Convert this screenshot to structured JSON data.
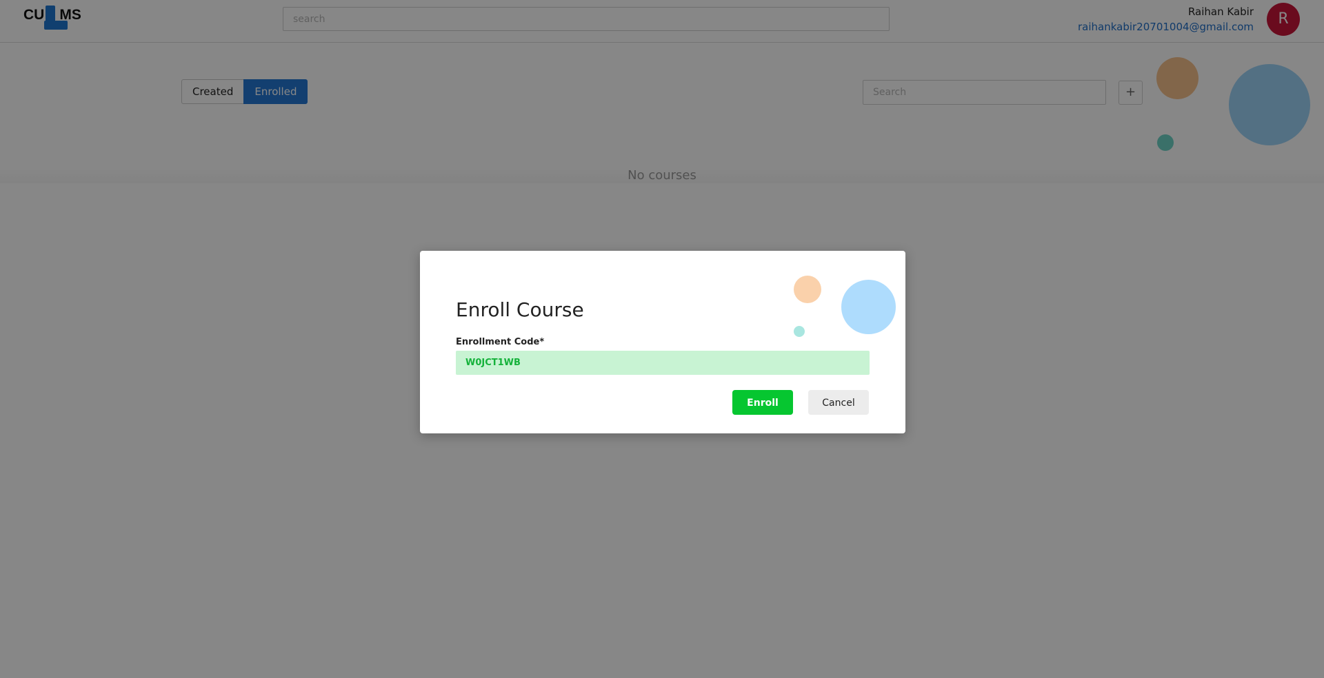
{
  "header": {
    "logo_left": "CU",
    "logo_right": "MS",
    "search_placeholder": "search",
    "user_name": "Raihan Kabir",
    "user_email": "raihankabir20701004@gmail.com",
    "avatar_initial": "R",
    "avatar_color": "#c8163a"
  },
  "main": {
    "tabs": [
      {
        "label": "Created",
        "active": false
      },
      {
        "label": "Enrolled",
        "active": true
      }
    ],
    "search_placeholder": "Search",
    "add_label": "+",
    "empty_text": "No courses",
    "accent_color": "#2478d4"
  },
  "modal": {
    "title": "Enroll Course",
    "field_label": "Enrollment Code*",
    "code_value": "W0JCT1WB",
    "enroll_label": "Enroll",
    "cancel_label": "Cancel",
    "enroll_color": "#06c630"
  }
}
